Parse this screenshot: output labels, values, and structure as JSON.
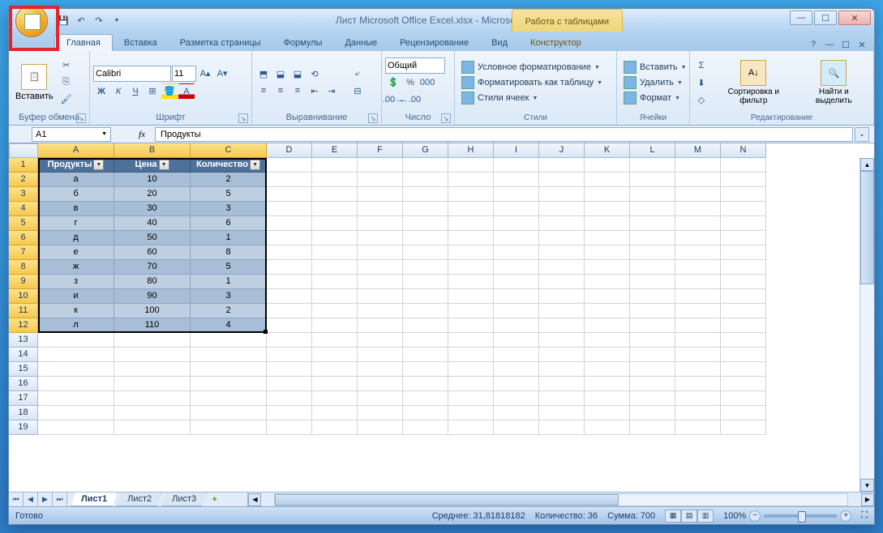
{
  "title": "Лист Microsoft Office Excel.xlsx - Microsoft Excel",
  "contextTabGroup": "Работа с таблицами",
  "tabs": [
    "Главная",
    "Вставка",
    "Разметка страницы",
    "Формулы",
    "Данные",
    "Рецензирование",
    "Вид",
    "Конструктор"
  ],
  "activeTab": 0,
  "ribbon": {
    "clipboard": {
      "label": "Буфер обмена",
      "paste": "Вставить"
    },
    "font": {
      "label": "Шрифт",
      "name": "Calibri",
      "size": "11"
    },
    "alignment": {
      "label": "Выравнивание"
    },
    "number": {
      "label": "Число",
      "format": "Общий"
    },
    "styles": {
      "label": "Стили",
      "conditional": "Условное форматирование",
      "formatTable": "Форматировать как таблицу",
      "cellStyles": "Стили ячеек"
    },
    "cells": {
      "label": "Ячейки",
      "insert": "Вставить",
      "delete": "Удалить",
      "format": "Формат"
    },
    "editing": {
      "label": "Редактирование",
      "sort": "Сортировка и фильтр",
      "find": "Найти и выделить"
    }
  },
  "nameBox": "A1",
  "formula": "Продукты",
  "table": {
    "headers": [
      "Продукты",
      "Цена",
      "Количество"
    ],
    "rows": [
      [
        "а",
        "10",
        "2"
      ],
      [
        "б",
        "20",
        "5"
      ],
      [
        "в",
        "30",
        "3"
      ],
      [
        "г",
        "40",
        "6"
      ],
      [
        "д",
        "50",
        "1"
      ],
      [
        "е",
        "60",
        "8"
      ],
      [
        "ж",
        "70",
        "5"
      ],
      [
        "з",
        "80",
        "1"
      ],
      [
        "и",
        "90",
        "3"
      ],
      [
        "к",
        "100",
        "2"
      ],
      [
        "л",
        "110",
        "4"
      ]
    ]
  },
  "columns": [
    "A",
    "B",
    "C",
    "D",
    "E",
    "F",
    "G",
    "H",
    "I",
    "J",
    "K",
    "L",
    "M",
    "N"
  ],
  "sheets": [
    "Лист1",
    "Лист2",
    "Лист3"
  ],
  "activeSheet": 0,
  "status": {
    "ready": "Готово",
    "avg": "Среднее: 31,81818182",
    "count": "Количество: 36",
    "sum": "Сумма: 700",
    "zoom": "100%"
  }
}
